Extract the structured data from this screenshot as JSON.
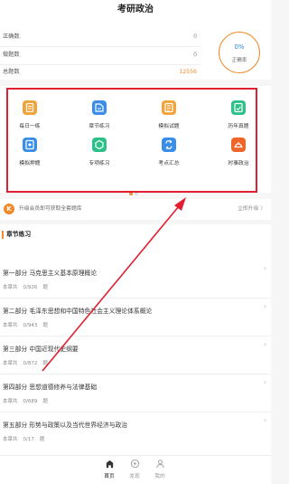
{
  "header": {
    "title": "考研政治"
  },
  "stats": {
    "rows": [
      {
        "label": "正确数",
        "value": "0"
      },
      {
        "label": "做题数",
        "value": "0"
      },
      {
        "label": "总题数",
        "value": "12556"
      }
    ],
    "accuracy": {
      "percent": "0%",
      "label": "正确率"
    }
  },
  "grid": {
    "tiles": [
      {
        "label": "每日一练",
        "icon": "daily-practice-icon",
        "color": "#f2a33a"
      },
      {
        "label": "章节练习",
        "icon": "chapter-practice-icon",
        "color": "#3a8ee8"
      },
      {
        "label": "模拟试题",
        "icon": "mock-exam-icon",
        "color": "#f2a33a"
      },
      {
        "label": "历年真题",
        "icon": "past-papers-icon",
        "color": "#2fbf8a"
      },
      {
        "label": "模拟押题",
        "icon": "predicted-questions-icon",
        "color": "#3a8ee8"
      },
      {
        "label": "专项练习",
        "icon": "special-practice-icon",
        "color": "#2fbf8a"
      },
      {
        "label": "考点汇总",
        "icon": "key-points-icon",
        "color": "#3a8ee8"
      },
      {
        "label": "时事政治",
        "icon": "current-affairs-icon",
        "color": "#f0652a"
      }
    ],
    "page_dots": {
      "count": 2,
      "active": 0,
      "active_color": "#f08a2a",
      "inactive_color": "#dddddd"
    }
  },
  "upgrade": {
    "badge": "K",
    "text": "升级会员即可获取全套题库",
    "action": "立即升级 〉"
  },
  "section": {
    "title": "章节练习",
    "items": [
      {
        "name": "第一部分 马克思主义基本原理概论",
        "meta_prefix": "本章共",
        "count": "0/926",
        "unit": "题"
      },
      {
        "name": "第二部分 毛泽东思想和中国特色社会主义理论体系概论",
        "meta_prefix": "本章共",
        "count": "0/943",
        "unit": "题"
      },
      {
        "name": "第三部分 中国近现代史纲要",
        "meta_prefix": "本章共",
        "count": "0/872",
        "unit": "题"
      },
      {
        "name": "第四部分 思想道德修养与法律基础",
        "meta_prefix": "本章共",
        "count": "0/689",
        "unit": "题"
      },
      {
        "name": "第五部分 形势与政策以及当代世界经济与政治",
        "meta_prefix": "本章共",
        "count": "0/17",
        "unit": "题"
      }
    ],
    "chevron": "›"
  },
  "tabbar": {
    "tabs": [
      {
        "label": "首页",
        "icon": "home-icon",
        "active": true
      },
      {
        "label": "发现",
        "icon": "discover-icon",
        "active": false
      },
      {
        "label": "我的",
        "icon": "profile-icon",
        "active": false
      }
    ]
  },
  "annotation": {
    "box_color": "#e02030",
    "arrow_color": "#e02030"
  }
}
